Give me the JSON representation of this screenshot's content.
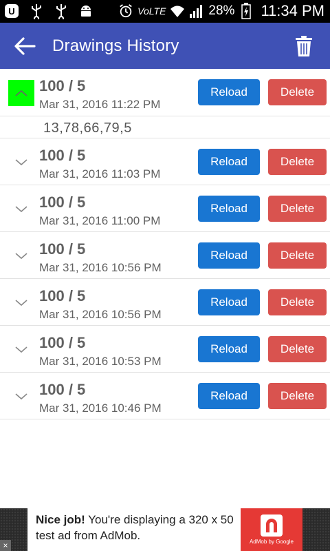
{
  "status_bar": {
    "battery_percent": "28%",
    "time": "11:34 PM",
    "network": "VoLTE"
  },
  "app_bar": {
    "title": "Drawings History",
    "back_icon": "arrow-back-icon",
    "trash_icon": "trash-icon"
  },
  "colors": {
    "app_bar": "#3F51B5",
    "reload": "#1976D2",
    "delete": "#D9534F",
    "expanded_highlight": "#00FF00"
  },
  "history": {
    "reload_label": "Reload",
    "delete_label": "Delete",
    "items": [
      {
        "title": "100 / 5",
        "date": "Mar 31, 2016 11:22 PM",
        "expanded": true,
        "numbers": "13,78,66,79,5"
      },
      {
        "title": "100 / 5",
        "date": "Mar 31, 2016 11:03 PM",
        "expanded": false
      },
      {
        "title": "100 / 5",
        "date": "Mar 31, 2016 11:00 PM",
        "expanded": false
      },
      {
        "title": "100 / 5",
        "date": "Mar 31, 2016 10:56 PM",
        "expanded": false
      },
      {
        "title": "100 / 5",
        "date": "Mar 31, 2016 10:56 PM",
        "expanded": false
      },
      {
        "title": "100 / 5",
        "date": "Mar 31, 2016 10:53 PM",
        "expanded": false
      },
      {
        "title": "100 / 5",
        "date": "Mar 31, 2016 10:46 PM",
        "expanded": false
      }
    ]
  },
  "ad": {
    "headline": "Nice job!",
    "body": "You're displaying a 320 x 50 test ad from AdMob.",
    "logo_caption": "AdMob by Google"
  }
}
